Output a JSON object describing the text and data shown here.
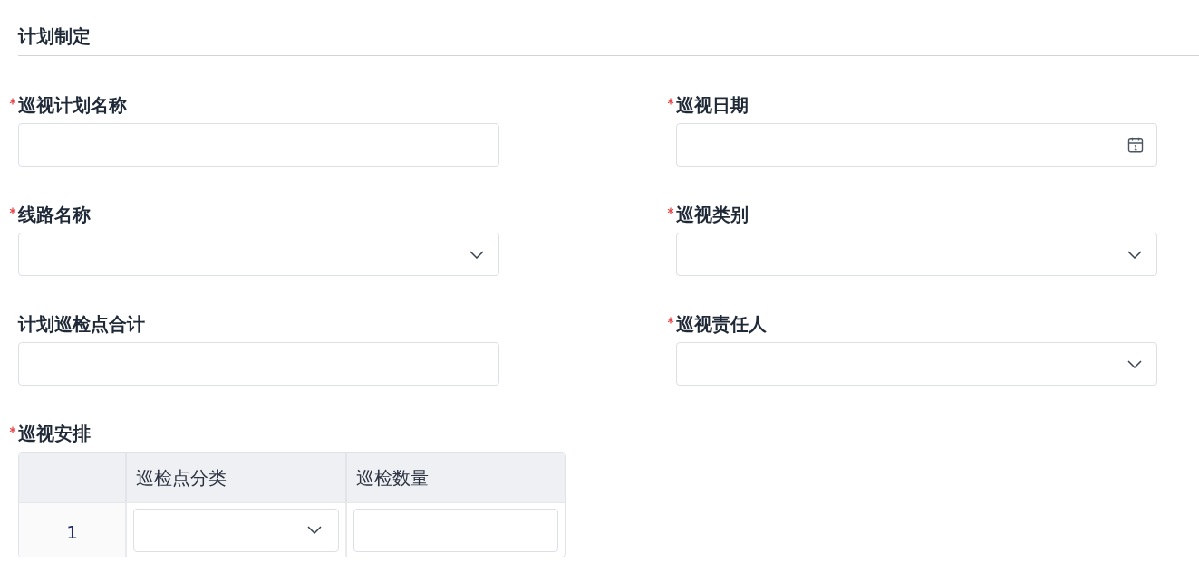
{
  "section": {
    "title": "计划制定"
  },
  "fields": [
    {
      "label": "巡视计划名称",
      "required": true,
      "kind": "text"
    },
    {
      "label": "巡视日期",
      "required": true,
      "kind": "date"
    },
    {
      "label": "线路名称",
      "required": true,
      "kind": "select"
    },
    {
      "label": "巡视类别",
      "required": true,
      "kind": "select"
    },
    {
      "label": "计划巡检点合计",
      "required": false,
      "kind": "text"
    },
    {
      "label": "巡视责任人",
      "required": true,
      "kind": "select"
    }
  ],
  "schedule": {
    "label": "巡视安排",
    "required": true,
    "table": {
      "columns": [
        "巡检点分类",
        "巡检数量"
      ],
      "rows": [
        {
          "index": "1",
          "cells": [
            {
              "kind": "select"
            },
            {
              "kind": "text"
            }
          ]
        }
      ]
    }
  }
}
